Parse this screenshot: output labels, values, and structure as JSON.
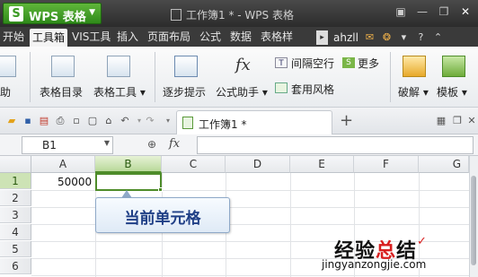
{
  "app": {
    "name": "WPS 表格",
    "logo_letter": "S",
    "window_title": "工作簿1 * - WPS 表格"
  },
  "menu": {
    "tabs": [
      "开始",
      "工具箱",
      "VIS工具",
      "插入",
      "页面布局",
      "公式",
      "数据",
      "表格样"
    ],
    "active": "工具箱",
    "user": "ahzll"
  },
  "ribbon": {
    "left_partial": "助",
    "table_catalog": "表格目录",
    "table_tools": "表格工具",
    "step_hint": "逐步提示",
    "formula_assistant": "公式助手",
    "interval_blank_row": "间隔空行",
    "more": "更多",
    "apply_style": "套用风格",
    "crack": "破解",
    "template": "模板"
  },
  "quickbar": {
    "doc_tab": "工作簿1 *"
  },
  "formula_bar": {
    "cell_ref": "B1",
    "fx": "fx",
    "value": ""
  },
  "sheet": {
    "columns": [
      "A",
      "B",
      "C",
      "D",
      "E",
      "F",
      "G"
    ],
    "selected_column": "B",
    "rows": [
      "1",
      "2",
      "3",
      "4",
      "5",
      "6"
    ],
    "selected_row": "1",
    "cells": {
      "A1": "50000"
    }
  },
  "callout": "当前单元格",
  "watermark": {
    "title_black": "经验",
    "title_red": "总",
    "title_black2": "结",
    "url": "jingyanzongjie.com"
  },
  "colors": {
    "accent": "#4e8c2a",
    "callout_text": "#1f3f86",
    "watermark_red": "#d81e1e"
  }
}
